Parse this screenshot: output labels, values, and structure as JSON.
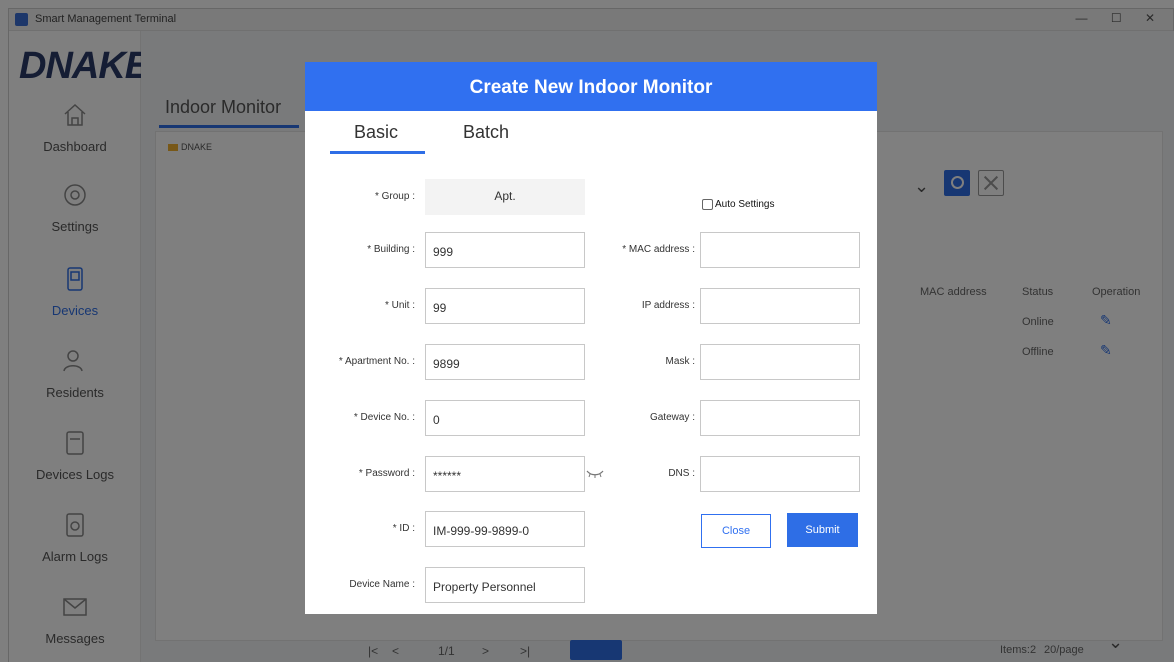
{
  "window": {
    "title": "Smart Management Terminal"
  },
  "brand": {
    "logo_text": "DNAKE"
  },
  "sidebar": {
    "items": [
      {
        "label": "Dashboard",
        "icon": "home-icon"
      },
      {
        "label": "Settings",
        "icon": "settings-icon"
      },
      {
        "label": "Devices",
        "icon": "devices-icon",
        "active": true
      },
      {
        "label": "Residents",
        "icon": "residents-icon"
      },
      {
        "label": "Devices Logs",
        "icon": "device-log-icon"
      },
      {
        "label": "Alarm Logs",
        "icon": "alarm-log-icon"
      },
      {
        "label": "Messages",
        "icon": "message-icon"
      }
    ]
  },
  "page": {
    "tab_label": "Indoor Monitor",
    "tree_root": "DNAKE",
    "table": {
      "headers": [
        "MAC address",
        "Status",
        "Operation"
      ],
      "rows": [
        {
          "status": "Online"
        },
        {
          "status": "Offline"
        }
      ]
    },
    "pager": {
      "first": "|<",
      "prev": "<",
      "page_info": "1/1",
      "next": ">",
      "last": ">|",
      "total": "Items:2",
      "page_size": "20/page"
    }
  },
  "modal": {
    "title": "Create New Indoor Monitor",
    "tabs": {
      "basic": "Basic",
      "batch": "Batch"
    },
    "fields": {
      "group": {
        "label": "* Group :",
        "value": "Apt."
      },
      "building": {
        "label": "* Building :",
        "value": "999"
      },
      "unit": {
        "label": "* Unit :",
        "value": "99"
      },
      "apartment": {
        "label": "* Apartment No. :",
        "value": "9899"
      },
      "device_no": {
        "label": "* Device No. :",
        "value": "0"
      },
      "password": {
        "label": "* Password :",
        "value": "******"
      },
      "id": {
        "label": "* ID :",
        "value": "IM-999-99-9899-0"
      },
      "device_name": {
        "label": "Device Name :",
        "value": "Property Personnel"
      },
      "mac": {
        "label": "* MAC address :",
        "value": ""
      },
      "ip": {
        "label": "IP address :",
        "value": ""
      },
      "mask": {
        "label": "Mask :",
        "value": ""
      },
      "gateway": {
        "label": "Gateway :",
        "value": ""
      },
      "dns": {
        "label": "DNS :",
        "value": ""
      }
    },
    "auto_settings": {
      "label": "Auto Settings",
      "checked": false
    },
    "buttons": {
      "close": "Close",
      "submit": "Submit"
    }
  },
  "colors": {
    "accent": "#3070f0",
    "overlay": "rgba(0,0,0,0.5)",
    "input_border": "#c8c8c8",
    "grey_field": "#f3f3f3"
  }
}
